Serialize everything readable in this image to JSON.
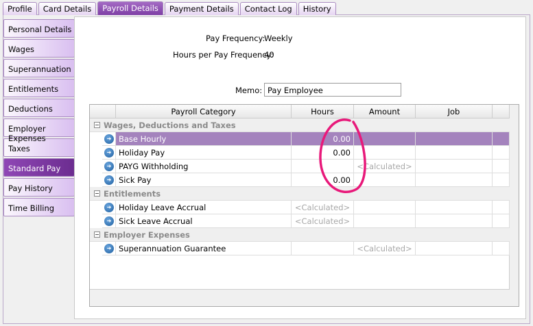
{
  "tabs": [
    "Profile",
    "Card Details",
    "Payroll Details",
    "Payment Details",
    "Contact Log",
    "History"
  ],
  "active_tab": "Payroll Details",
  "sidebar": [
    "Personal Details",
    "Wages",
    "Superannuation",
    "Entitlements",
    "Deductions",
    "Employer Expenses",
    "Taxes",
    "Standard Pay",
    "Pay History",
    "Time Billing"
  ],
  "active_sidebar": "Standard Pay",
  "pay_frequency": {
    "label": "Pay Frequency:",
    "value": "Weekly"
  },
  "hours_per": {
    "label": "Hours per Pay Frequency:",
    "value": "40"
  },
  "memo": {
    "label": "Memo:",
    "value": "Pay Employee"
  },
  "grid": {
    "headers": [
      "Payroll Category",
      "Hours",
      "Amount",
      "Job"
    ],
    "groups": [
      {
        "name": "Wages, Deductions and Taxes",
        "rows": [
          {
            "category": "Base Hourly",
            "hours": "0.00",
            "amount": "",
            "job": "",
            "selected": true
          },
          {
            "category": "Holiday Pay",
            "hours": "0.00",
            "amount": "",
            "job": ""
          },
          {
            "category": "PAYG Withholding",
            "hours": "",
            "amount": "<Calculated>",
            "job": ""
          },
          {
            "category": "Sick Pay",
            "hours": "0.00",
            "amount": "",
            "job": ""
          }
        ]
      },
      {
        "name": "Entitlements",
        "rows": [
          {
            "category": "Holiday Leave Accrual",
            "hours": "<Calculated>",
            "amount": "",
            "job": ""
          },
          {
            "category": "Sick Leave Accrual",
            "hours": "<Calculated>",
            "amount": "",
            "job": ""
          }
        ]
      },
      {
        "name": "Employer Expenses",
        "rows": [
          {
            "category": "Superannuation Guarantee",
            "hours": "",
            "amount": "<Calculated>",
            "job": ""
          }
        ]
      }
    ]
  },
  "colors": {
    "accent": "#7e3fa5",
    "selected_row": "#a483bd",
    "annotation": "#e8197a"
  }
}
